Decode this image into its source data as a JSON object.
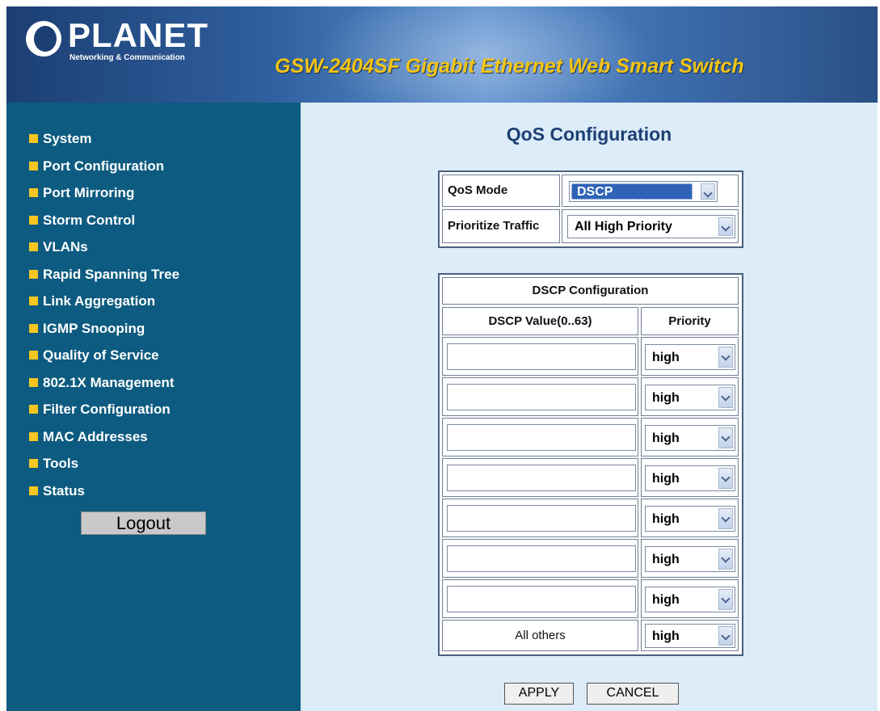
{
  "header": {
    "brand": "PLANET",
    "tagline": "Networking & Communication",
    "product_title": "GSW-2404SF Gigabit Ethernet Web Smart Switch"
  },
  "sidebar": {
    "items": [
      {
        "label": "System"
      },
      {
        "label": "Port Configuration"
      },
      {
        "label": "Port Mirroring"
      },
      {
        "label": "Storm Control"
      },
      {
        "label": "VLANs"
      },
      {
        "label": "Rapid Spanning Tree"
      },
      {
        "label": "Link Aggregation"
      },
      {
        "label": "IGMP Snooping"
      },
      {
        "label": "Quality of Service"
      },
      {
        "label": "802.1X Management"
      },
      {
        "label": "Filter Configuration"
      },
      {
        "label": "MAC Addresses"
      },
      {
        "label": "Tools"
      },
      {
        "label": "Status"
      }
    ],
    "logout_label": "Logout"
  },
  "main": {
    "title": "QoS Configuration",
    "qos_mode": {
      "label": "QoS Mode",
      "value": "DSCP"
    },
    "prioritize_traffic": {
      "label": "Prioritize Traffic",
      "value": "All High Priority"
    },
    "dscp": {
      "title": "DSCP Configuration",
      "col_value": "DSCP Value(0..63)",
      "col_priority": "Priority",
      "rows": [
        {
          "value": "",
          "priority": "high"
        },
        {
          "value": "",
          "priority": "high"
        },
        {
          "value": "",
          "priority": "high"
        },
        {
          "value": "",
          "priority": "high"
        },
        {
          "value": "",
          "priority": "high"
        },
        {
          "value": "",
          "priority": "high"
        },
        {
          "value": "",
          "priority": "high"
        }
      ],
      "all_others_label": "All others",
      "all_others_priority": "high"
    },
    "apply_label": "APPLY",
    "cancel_label": "CANCEL"
  },
  "colors": {
    "sidebar_bg": "#0d5b80",
    "main_bg": "#dcecf8",
    "bullet": "#f5c520",
    "title": "#1d3f74",
    "product_title": "#f3c512"
  }
}
